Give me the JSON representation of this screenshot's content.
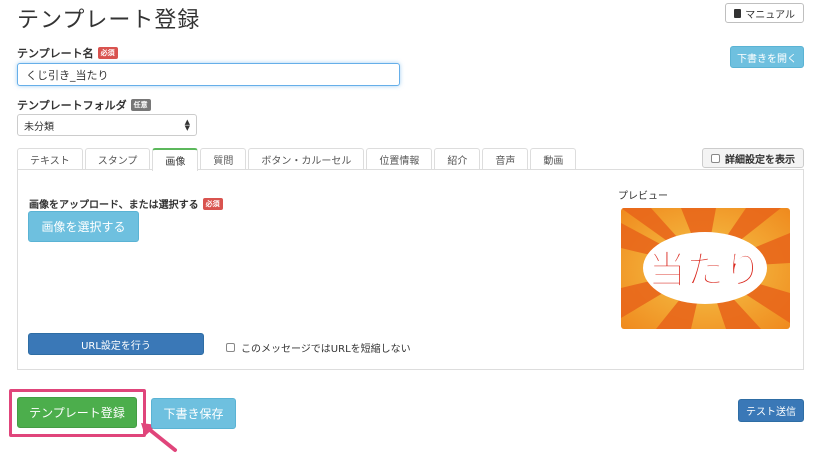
{
  "page": {
    "title": "テンプレート登録"
  },
  "header": {
    "manual_label": "マニュアル",
    "manual_icon": "book-icon",
    "open_draft_label": "下書きを開く"
  },
  "form": {
    "name_label": "テンプレート名",
    "required_badge": "必須",
    "name_value": "くじ引き_当たり",
    "folder_label": "テンプレートフォルダ",
    "optional_badge": "任意",
    "folder_value": "未分類"
  },
  "tabs": [
    {
      "label": "テキスト"
    },
    {
      "label": "スタンプ"
    },
    {
      "label": "画像"
    },
    {
      "label": "質問"
    },
    {
      "label": "ボタン・カルーセル"
    },
    {
      "label": "位置情報"
    },
    {
      "label": "紹介"
    },
    {
      "label": "音声"
    },
    {
      "label": "動画"
    }
  ],
  "active_tab": "画像",
  "detail_toggle_label": "詳細設定を表示",
  "image_panel": {
    "upload_label": "画像をアップロード、または選択する",
    "required_badge": "必須",
    "select_button": "画像を選択する",
    "preview_label": "プレビュー",
    "preview_image_text": "当たり",
    "url_button": "URL設定を行う",
    "no_shorten_label": "このメッセージではURLを短縮しない"
  },
  "footer": {
    "register_button": "テンプレート登録",
    "save_draft_button": "下書き保存",
    "test_send_button": "テスト送信"
  },
  "colors": {
    "accent_green": "#4cae4c",
    "accent_blue": "#3a78b7",
    "accent_light_blue": "#6ec0df",
    "required_red": "#d9534f",
    "highlight_pink": "#e0457b"
  }
}
